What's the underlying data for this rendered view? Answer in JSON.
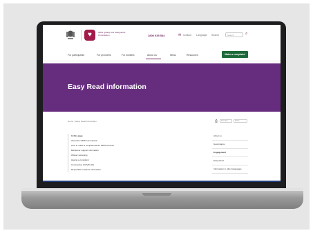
{
  "header": {
    "logo_text": "NDIS Quality and Safeguards Commission",
    "phone": "1800 035 544",
    "utility_links": [
      "Contact",
      "Language",
      "Search"
    ],
    "search_placeholder": "Search"
  },
  "nav": {
    "items": [
      "For participants",
      "For providers",
      "For workers",
      "About us",
      "News",
      "Resources"
    ],
    "active": "About us",
    "cta_label": "Make a complaint"
  },
  "banner": {
    "title": "Easy Read information",
    "color": "#662d7f"
  },
  "breadcrumb": "Home > Easy Read information",
  "toolbar": {
    "print": "print-icon",
    "text_size": "Text size",
    "share": "Share"
  },
  "contents": {
    "heading": "In this page",
    "items": [
      "About the NDIS Commission",
      "How to make a complaint about NDIS services",
      "Behaviour support information",
      "Worker screening",
      "Having a complaint",
      "Coronavirus (COVID-19)",
      "Reportable incidents information"
    ]
  },
  "side_nav": {
    "items": [
      "About us",
      "Governance",
      "Engagement",
      "Easy Read",
      "Information in other languages"
    ]
  },
  "colors": {
    "brand_purple": "#662d7f",
    "cta_green": "#1d6b3a",
    "logo_red": "#a21b4a"
  }
}
